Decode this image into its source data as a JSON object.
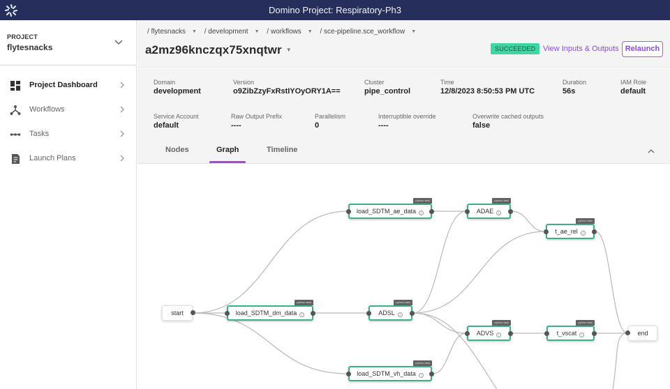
{
  "topbar": {
    "title": "Domino Project: Respiratory-Ph3",
    "logo_icon": "domino-logo-icon"
  },
  "sidebar": {
    "project_label": "PROJECT",
    "project_name": "flytesnacks",
    "items": [
      {
        "label": "Project Dashboard",
        "icon": "dashboard-icon",
        "active": true
      },
      {
        "label": "Workflows",
        "icon": "workflow-icon",
        "active": false
      },
      {
        "label": "Tasks",
        "icon": "tasks-icon",
        "active": false
      },
      {
        "label": "Launch Plans",
        "icon": "launch-plan-icon",
        "active": false
      }
    ]
  },
  "header": {
    "breadcrumbs": [
      "/ flytesnacks",
      "/ development",
      "/ workflows",
      "/ sce-pipeline.sce_workflow"
    ],
    "execution_id": "a2mz96knczqx75xnqtwr",
    "status": "SUCCEEDED",
    "status_color": "#3fd6a4",
    "view_io_label": "View Inputs & Outputs",
    "relaunch_label": "Relaunch",
    "accent_color": "#8b4bd9"
  },
  "details": {
    "row1": [
      {
        "key": "Domain",
        "value": "development"
      },
      {
        "key": "Version",
        "value": "o9ZibZzyFxRstIYOyORY1A=="
      },
      {
        "key": "Cluster",
        "value": "pipe_control"
      },
      {
        "key": "Time",
        "value": "12/8/2023 8:50:53 PM UTC"
      },
      {
        "key": "Duration",
        "value": "56s"
      },
      {
        "key": "IAM Role",
        "value": "default"
      }
    ],
    "row2": [
      {
        "key": "Service Account",
        "value": "default"
      },
      {
        "key": "Raw Output Prefix",
        "value": "----"
      },
      {
        "key": "Parallelism",
        "value": "0"
      },
      {
        "key": "Interruptible override",
        "value": "----"
      },
      {
        "key": "Overwrite cached outputs",
        "value": "false"
      }
    ]
  },
  "tabs": [
    {
      "label": "Nodes",
      "active": false
    },
    {
      "label": "Graph",
      "active": true
    },
    {
      "label": "Timeline",
      "active": false
    }
  ],
  "graph": {
    "task_tag": "python-task",
    "nodes": {
      "start": {
        "label": "start"
      },
      "load_dm": {
        "label": "load_SDTM_dm_data"
      },
      "load_ae": {
        "label": "load_SDTM_ae_data"
      },
      "load_vh": {
        "label": "load_SDTM_vh_data"
      },
      "adsl": {
        "label": "ADSL"
      },
      "adae": {
        "label": "ADAE"
      },
      "advs": {
        "label": "ADVS"
      },
      "t_ae_rel": {
        "label": "t_ae_rel"
      },
      "t_vscat": {
        "label": "t_vscat"
      },
      "end": {
        "label": "end"
      }
    },
    "edges": [
      [
        "start",
        "load_dm"
      ],
      [
        "start",
        "load_ae"
      ],
      [
        "start",
        "load_vh"
      ],
      [
        "load_dm",
        "adsl"
      ],
      [
        "load_ae",
        "adae"
      ],
      [
        "adsl",
        "adae"
      ],
      [
        "adsl",
        "t_ae_rel"
      ],
      [
        "adae",
        "t_ae_rel"
      ],
      [
        "adsl",
        "advs"
      ],
      [
        "load_vh",
        "advs"
      ],
      [
        "advs",
        "t_vscat"
      ],
      [
        "t_ae_rel",
        "end"
      ],
      [
        "t_vscat",
        "end"
      ]
    ]
  }
}
